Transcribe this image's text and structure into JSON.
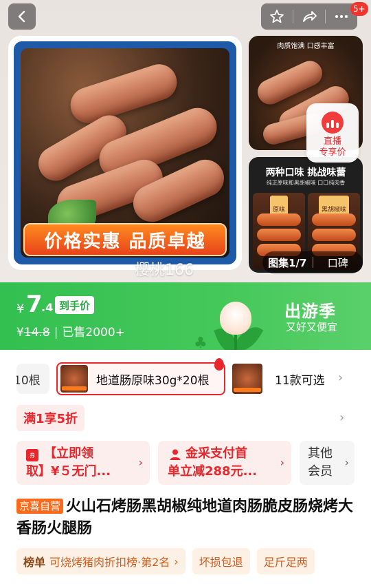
{
  "gallery": {
    "main_banner": "价格实惠 品质卓越",
    "watermark": "樱桃166",
    "side1_caption": "肉质饱满 口感丰富",
    "side2_caption": "两种口味 挑战味蕾",
    "side2_sub": "纯正原味和黑胡椒味 口口纯肉香",
    "flavor_1": "原味",
    "flavor_2": "黑胡椒味",
    "live_badge": {
      "line1": "直播",
      "line2": "专享价"
    },
    "album": {
      "counter": "图集1/7",
      "review": "口碑"
    }
  },
  "top_bar": {
    "notification_badge": "5+",
    "icons": [
      "back-icon",
      "star-icon",
      "share-icon",
      "more-icon"
    ]
  },
  "price": {
    "currency": "¥",
    "integer": "7",
    "decimal": ".4",
    "label": "到手价",
    "original_prefix": "¥",
    "original_value": "14.8",
    "sold": "已售2000+",
    "promo_title": "出游季",
    "promo_sub": "又好又便宜"
  },
  "sku": {
    "prev_label": "10根",
    "selected_label": "地道肠原味30g*20根",
    "count_label": "11款可选"
  },
  "discount": "满1享5折",
  "coupons": [
    {
      "line1": "【立即领",
      "line2": "取】¥５无门..."
    },
    {
      "line1": "金采支付首",
      "line2": "单立减288元..."
    },
    {
      "line1": "其他",
      "line2": "会员"
    }
  ],
  "product": {
    "store_badge": "京喜自营",
    "title": "火山石烤肠黑胡椒纯地道肉肠脆皮肠烧烤大香肠火腿肠"
  },
  "tags": {
    "rank_label": "榜单",
    "rank_text": "可烧烤猪肉折扣榜·第2名",
    "tag2": "坏损包退",
    "tag3": "足斤足两"
  },
  "colors": {
    "accent_red": "#e8262b",
    "price_green": "#3cc455",
    "store_orange": "#ff6a1a"
  }
}
